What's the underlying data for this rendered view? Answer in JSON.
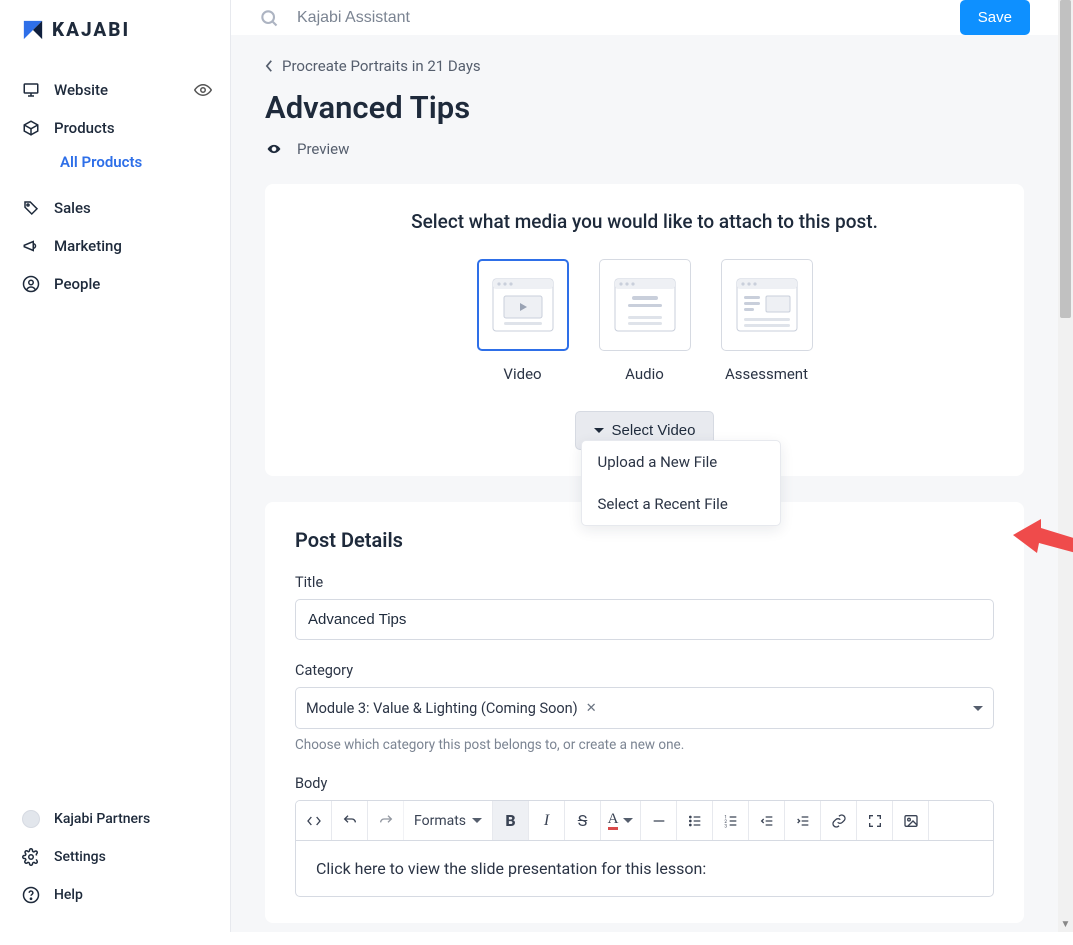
{
  "brand": {
    "name": "KAJABI"
  },
  "sidebar": {
    "items": [
      {
        "label": "Website"
      },
      {
        "label": "Products"
      },
      {
        "label": "Sales"
      },
      {
        "label": "Marketing"
      },
      {
        "label": "People"
      }
    ],
    "sub_item": "All Products",
    "footer": {
      "partners": "Kajabi Partners",
      "settings": "Settings",
      "help": "Help"
    }
  },
  "topbar": {
    "search_placeholder": "Kajabi Assistant",
    "save": "Save"
  },
  "page": {
    "breadcrumb": "Procreate Portraits in 21 Days",
    "title": "Advanced Tips",
    "preview": "Preview"
  },
  "media": {
    "prompt": "Select what media you would like to attach to this post.",
    "types": [
      {
        "label": "Video"
      },
      {
        "label": "Audio"
      },
      {
        "label": "Assessment"
      }
    ],
    "select_button": "Select Video",
    "menu": {
      "upload": "Upload a New File",
      "recent": "Select a Recent File"
    }
  },
  "details": {
    "heading": "Post Details",
    "title_label": "Title",
    "title_value": "Advanced Tips",
    "category_label": "Category",
    "category_value": "Module 3: Value & Lighting (Coming Soon)",
    "category_hint": "Choose which category this post belongs to, or create a new one.",
    "body_label": "Body",
    "formats_label": "Formats",
    "body_text": "Click here to view the slide presentation for this lesson:"
  }
}
